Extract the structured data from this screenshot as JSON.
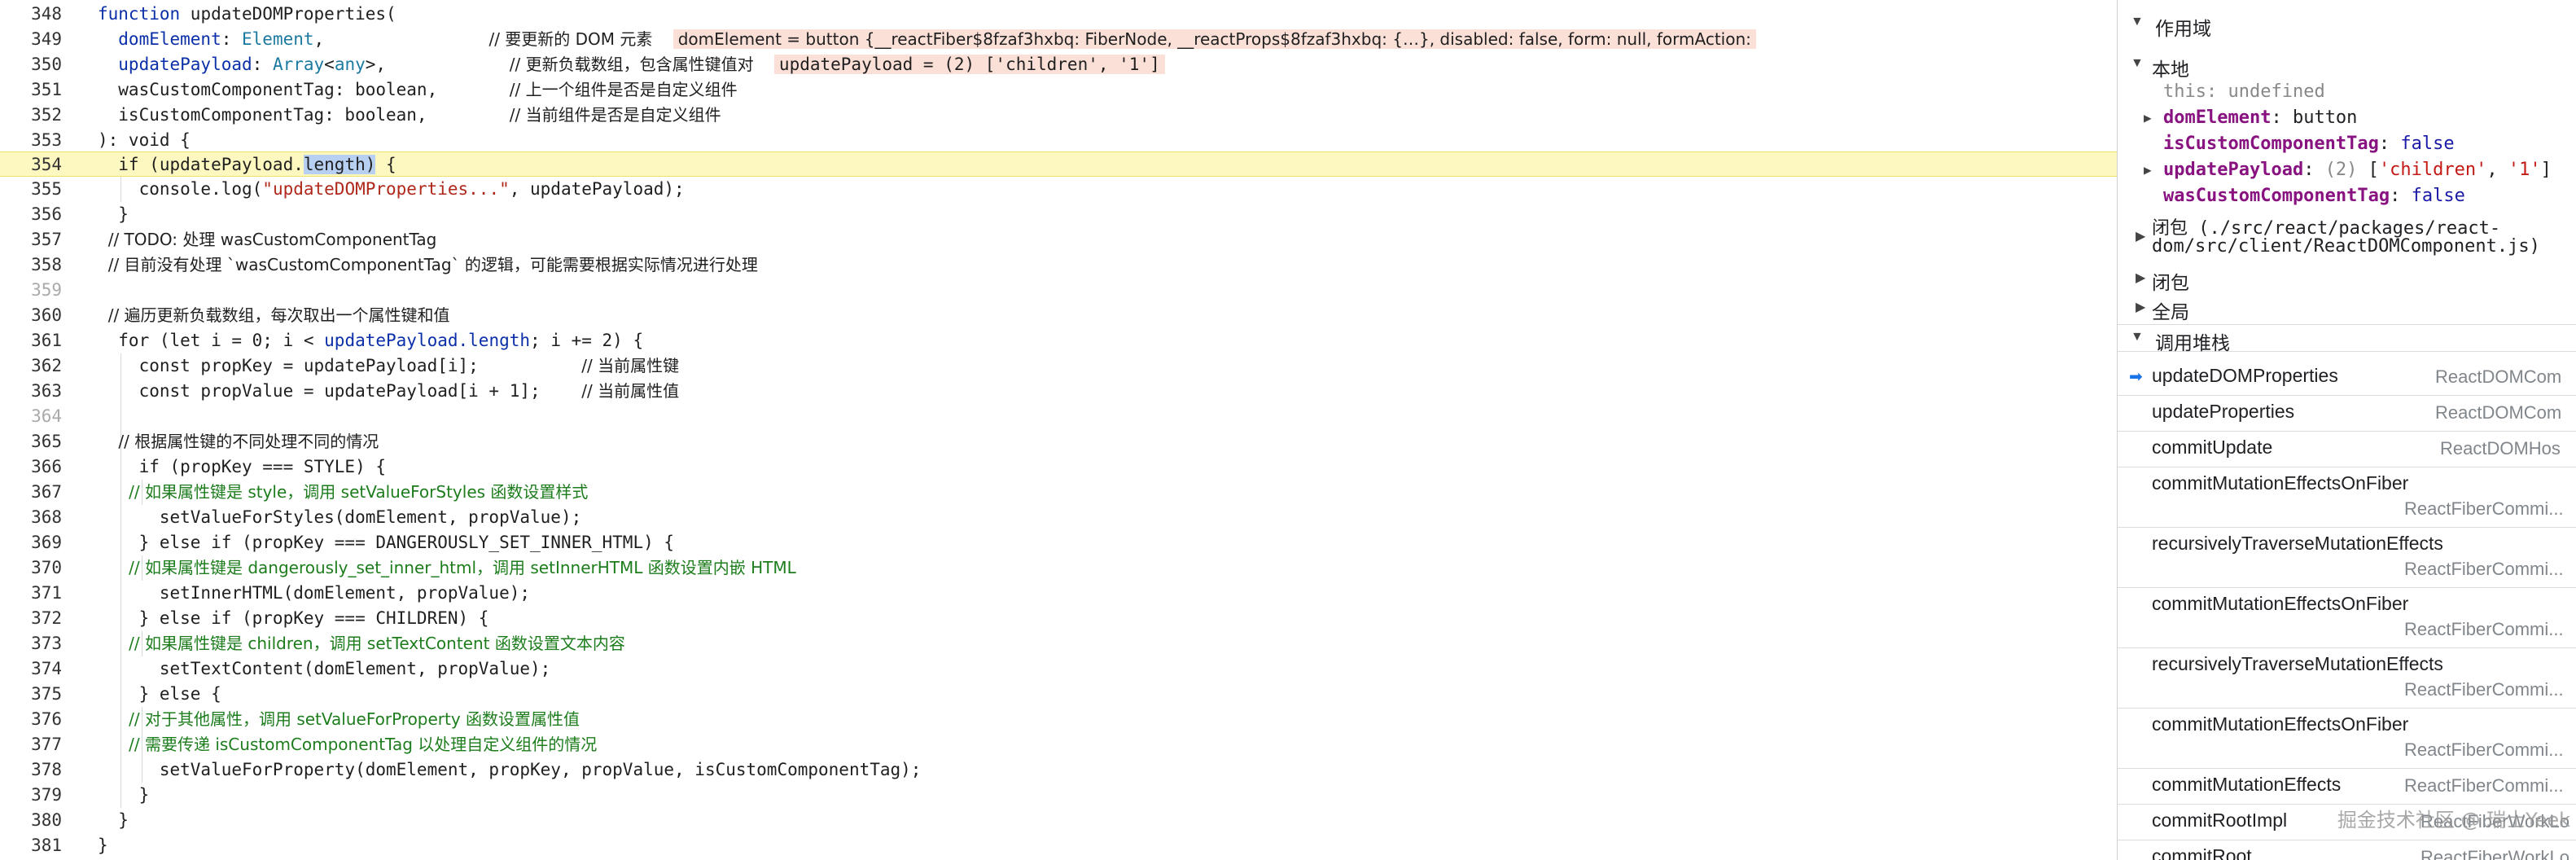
{
  "editor": {
    "lines": [
      {
        "n": "348"
      },
      {
        "n": "349"
      },
      {
        "n": "350"
      },
      {
        "n": "351"
      },
      {
        "n": "352"
      },
      {
        "n": "353"
      },
      {
        "n": "354"
      },
      {
        "n": "355"
      },
      {
        "n": "356"
      },
      {
        "n": "357"
      },
      {
        "n": "358"
      },
      {
        "n": "359"
      },
      {
        "n": "360"
      },
      {
        "n": "361"
      },
      {
        "n": "362"
      },
      {
        "n": "363"
      },
      {
        "n": "364"
      },
      {
        "n": "365"
      },
      {
        "n": "366"
      },
      {
        "n": "367"
      },
      {
        "n": "368"
      },
      {
        "n": "369"
      },
      {
        "n": "370"
      },
      {
        "n": "371"
      },
      {
        "n": "372"
      },
      {
        "n": "373"
      },
      {
        "n": "374"
      },
      {
        "n": "375"
      },
      {
        "n": "376"
      },
      {
        "n": "377"
      },
      {
        "n": "378"
      },
      {
        "n": "379"
      },
      {
        "n": "380"
      },
      {
        "n": "381"
      }
    ],
    "t": {
      "l348a": "function",
      "l348b": " updateDOMProperties(",
      "l349a": "  domElement",
      "l349b": ": ",
      "l349c": "Element",
      "l349d": ",                ",
      "l349e": "// 要更新的 DOM 元素",
      "l349f": "domElement = button {__reactFiber$8fzaf3hxbq: FiberNode, __reactProps$8fzaf3hxbq: {…}, disabled: false, form: null, formAction:",
      "l350a": "  updatePayload",
      "l350b": ": ",
      "l350c": "Array",
      "l350d": "<",
      "l350e": "any",
      "l350f": ">,            ",
      "l350g": "// 更新负载数组，包含属性键值对",
      "l350h": "updatePayload = (2) ['children', '1']",
      "l351a": "  wasCustomComponentTag: boolean,       ",
      "l351b": "// 上一个组件是否是自定义组件",
      "l352a": "  isCustomComponentTag: boolean,        ",
      "l352b": "// 当前组件是否是自定义组件",
      "l353a": "): void {",
      "l354a": "  if (updatePayload.",
      "l354b": "length)",
      "l354c": " {",
      "l355a": "    console.log(",
      "l355b": "\"updateDOMProperties...\"",
      "l355c": ", updatePayload);",
      "l356a": "  }",
      "l357a": "  // TODO: 处理 wasCustomComponentTag",
      "l358a": "  // 目前没有处理 `wasCustomComponentTag` 的逻辑，可能需要根据实际情况进行处理",
      "l360a": "  // 遍历更新负载数组，每次取出一个属性键和值",
      "l361a": "  for (let i = 0; i < ",
      "l361b": "updatePayload.length",
      "l361c": "; i += 2) {",
      "l362a": "    const propKey = updatePayload[i];          ",
      "l362b": "// 当前属性键",
      "l363a": "    const propValue = updatePayload[i + 1];    ",
      "l363b": "// 当前属性值",
      "l365a": "    // 根据属性键的不同处理不同的情况",
      "l366a": "    if (propKey === STYLE) {",
      "l367a": "      // 如果属性键是 style，调用 setValueForStyles 函数设置样式",
      "l368a": "      setValueForStyles(domElement, propValue);",
      "l369a": "    } else if (propKey === DANGEROUSLY_SET_INNER_HTML) {",
      "l370a": "      // 如果属性键是 dangerously_set_inner_html，调用 setInnerHTML 函数设置内嵌 HTML",
      "l371a": "      setInnerHTML(domElement, propValue);",
      "l372a": "    } else if (propKey === CHILDREN) {",
      "l373a": "      // 如果属性键是 children，调用 setTextContent 函数设置文本内容",
      "l374a": "      setTextContent(domElement, propValue);",
      "l375a": "    } else {",
      "l376a": "      // 对于其他属性，调用 setValueForProperty 函数设置属性值",
      "l377a": "      // 需要传递 isCustomComponentTag 以处理自定义组件的情况",
      "l378a": "      setValueForProperty(domElement, propKey, propValue, isCustomComponentTag);",
      "l379a": "    }",
      "l380a": "  }",
      "l381a": "}"
    }
  },
  "scope": {
    "title": "作用域",
    "local_title": "本地",
    "vars": {
      "this_name": "this",
      "this_val": "undefined",
      "dom_name": "domElement",
      "dom_val": "button",
      "isc_name": "isCustomComponentTag",
      "isc_val": "false",
      "up_name": "updatePayload",
      "up_count": "(2)",
      "up_val1": "'children'",
      "up_val2": "'1'",
      "was_name": "wasCustomComponentTag",
      "was_val": "false"
    },
    "closure_path": "闭包 (./src/react/packages/react-dom/src/client/ReactDOMComponent.js)",
    "closure_path_1": "闭包 (./src/react/packages/react-",
    "closure_path_2": "dom/src/client/ReactDOMComponent.js)",
    "closure": "闭包",
    "global": "全局"
  },
  "callstack": {
    "title": "调用堆栈",
    "frames": [
      {
        "name": "updateDOMProperties",
        "loc": "ReactDOMCom"
      },
      {
        "name": "updateProperties",
        "loc": "ReactDOMCom"
      },
      {
        "name": "commitUpdate",
        "loc": "ReactDOMHos"
      },
      {
        "name": "commitMutationEffectsOnFiber",
        "loc": "ReactFiberCommi..."
      },
      {
        "name": "recursivelyTraverseMutationEffects",
        "loc": "ReactFiberCommi..."
      },
      {
        "name": "commitMutationEffectsOnFiber",
        "loc": "ReactFiberCommi..."
      },
      {
        "name": "recursivelyTraverseMutationEffects",
        "loc": "ReactFiberCommi..."
      },
      {
        "name": "commitMutationEffectsOnFiber",
        "loc": "ReactFiberCommi..."
      },
      {
        "name": "commitMutationEffects",
        "loc": "ReactFiberCommi..."
      },
      {
        "name": "commitRootImpl",
        "loc": "ReactFiberWorkLo"
      },
      {
        "name": "commitRoot",
        "loc": "ReactFiberWorkLo"
      }
    ]
  },
  "watermark": "掘金技术社区 @ 瑞士Yeek"
}
